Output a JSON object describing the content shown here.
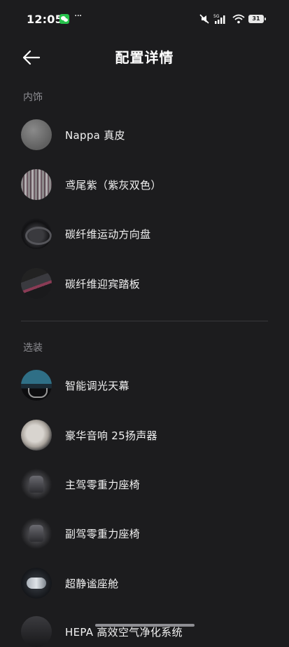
{
  "status_bar": {
    "time": "12:05",
    "more": "···",
    "network": "5G",
    "battery": "31"
  },
  "header": {
    "title": "配置详情"
  },
  "sections": [
    {
      "label": "内饰",
      "items": [
        {
          "label": "Nappa 真皮",
          "icon": "nappa-leather-swatch"
        },
        {
          "label": "鸢尾紫（紫灰双色）",
          "icon": "iris-purple-swatch"
        },
        {
          "label": "碳纤维运动方向盘",
          "icon": "steering-wheel-photo"
        },
        {
          "label": "碳纤维迎宾踏板",
          "icon": "door-sill-photo"
        }
      ]
    },
    {
      "label": "选装",
      "items": [
        {
          "label": "智能调光天幕",
          "icon": "sunroof-photo"
        },
        {
          "label": "豪华音响 25扬声器",
          "icon": "speaker-photo"
        },
        {
          "label": "主驾零重力座椅",
          "icon": "driver-seat-photo"
        },
        {
          "label": "副驾零重力座椅",
          "icon": "passenger-seat-photo"
        },
        {
          "label": "超静谧座舱",
          "icon": "quiet-cabin-photo"
        },
        {
          "label": "HEPA 高效空气净化系统",
          "icon": "air-purifier-photo"
        }
      ]
    }
  ]
}
